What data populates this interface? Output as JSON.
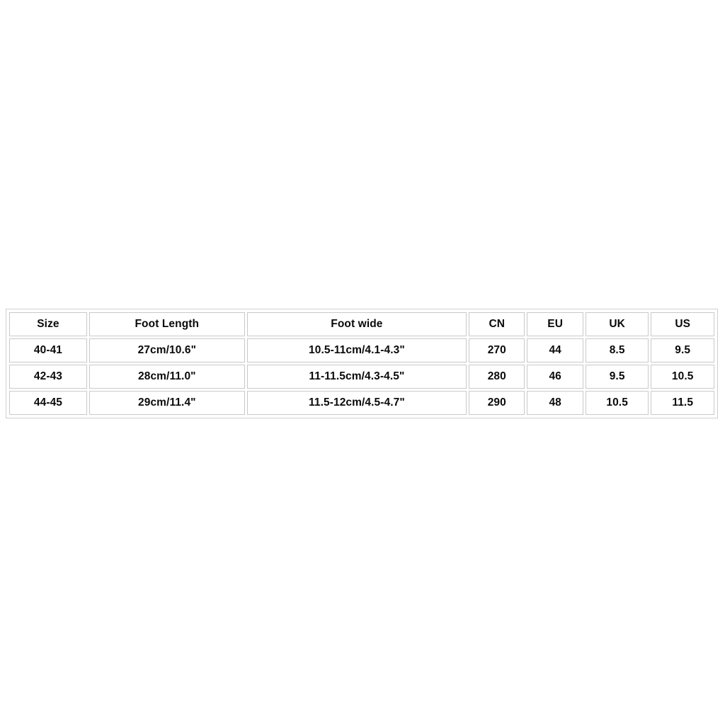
{
  "table": {
    "name": "shoe-size-chart",
    "columns": [
      "Size",
      "Foot Length",
      "Foot wide",
      "CN",
      "EU",
      "UK",
      "US"
    ],
    "rows": [
      {
        "size": "40-41",
        "foot_length": "27cm/10.6\"",
        "foot_wide": "10.5-11cm/4.1-4.3\"",
        "cn": "270",
        "eu": "44",
        "uk": "8.5",
        "us": "9.5"
      },
      {
        "size": "42-43",
        "foot_length": "28cm/11.0\"",
        "foot_wide": "11-11.5cm/4.3-4.5\"",
        "cn": "280",
        "eu": "46",
        "uk": "9.5",
        "us": "10.5"
      },
      {
        "size": "44-45",
        "foot_length": "29cm/11.4\"",
        "foot_wide": "11.5-12cm/4.5-4.7\"",
        "cn": "290",
        "eu": "48",
        "uk": "10.5",
        "us": "11.5"
      }
    ]
  },
  "colors": {
    "background": "#ffffff",
    "text": "#0a0a0a",
    "cell_border": "#c9c9c9",
    "outer_border": "#cfcfcf"
  }
}
